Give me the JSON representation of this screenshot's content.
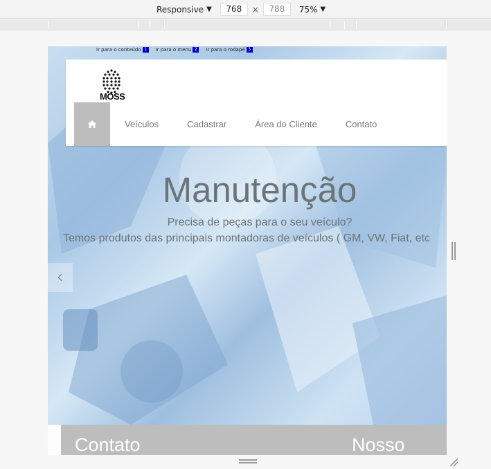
{
  "toolbar": {
    "device_mode": "Responsive",
    "width": "768",
    "height": "788",
    "dim_separator": "×",
    "zoom": "75%"
  },
  "page": {
    "skip_links": [
      {
        "label": "Ir para o conteúdo",
        "key": "1"
      },
      {
        "label": "Ir para o menu",
        "key": "2"
      },
      {
        "label": "Ir para o rodapé",
        "key": "3"
      }
    ],
    "logo_text": "MOSS",
    "nav": {
      "home_icon": "home-icon",
      "items": [
        "Veículos",
        "Cadastrar",
        "Área do Cliente",
        "Contato"
      ]
    },
    "hero": {
      "title": "Manutenção",
      "subtitle1": "Precisa de peças para o seu veículo?",
      "subtitle2": "Temos produtos das principais montadoras de veículos ( GM, VW, Fiat, etc"
    },
    "footer": {
      "heading1": "Contato",
      "heading2": "Nosso"
    }
  },
  "colors": {
    "nav_active_bg": "#bdbdbd",
    "skip_key_bg": "#0000cc",
    "hero_text": "#6b7478"
  }
}
